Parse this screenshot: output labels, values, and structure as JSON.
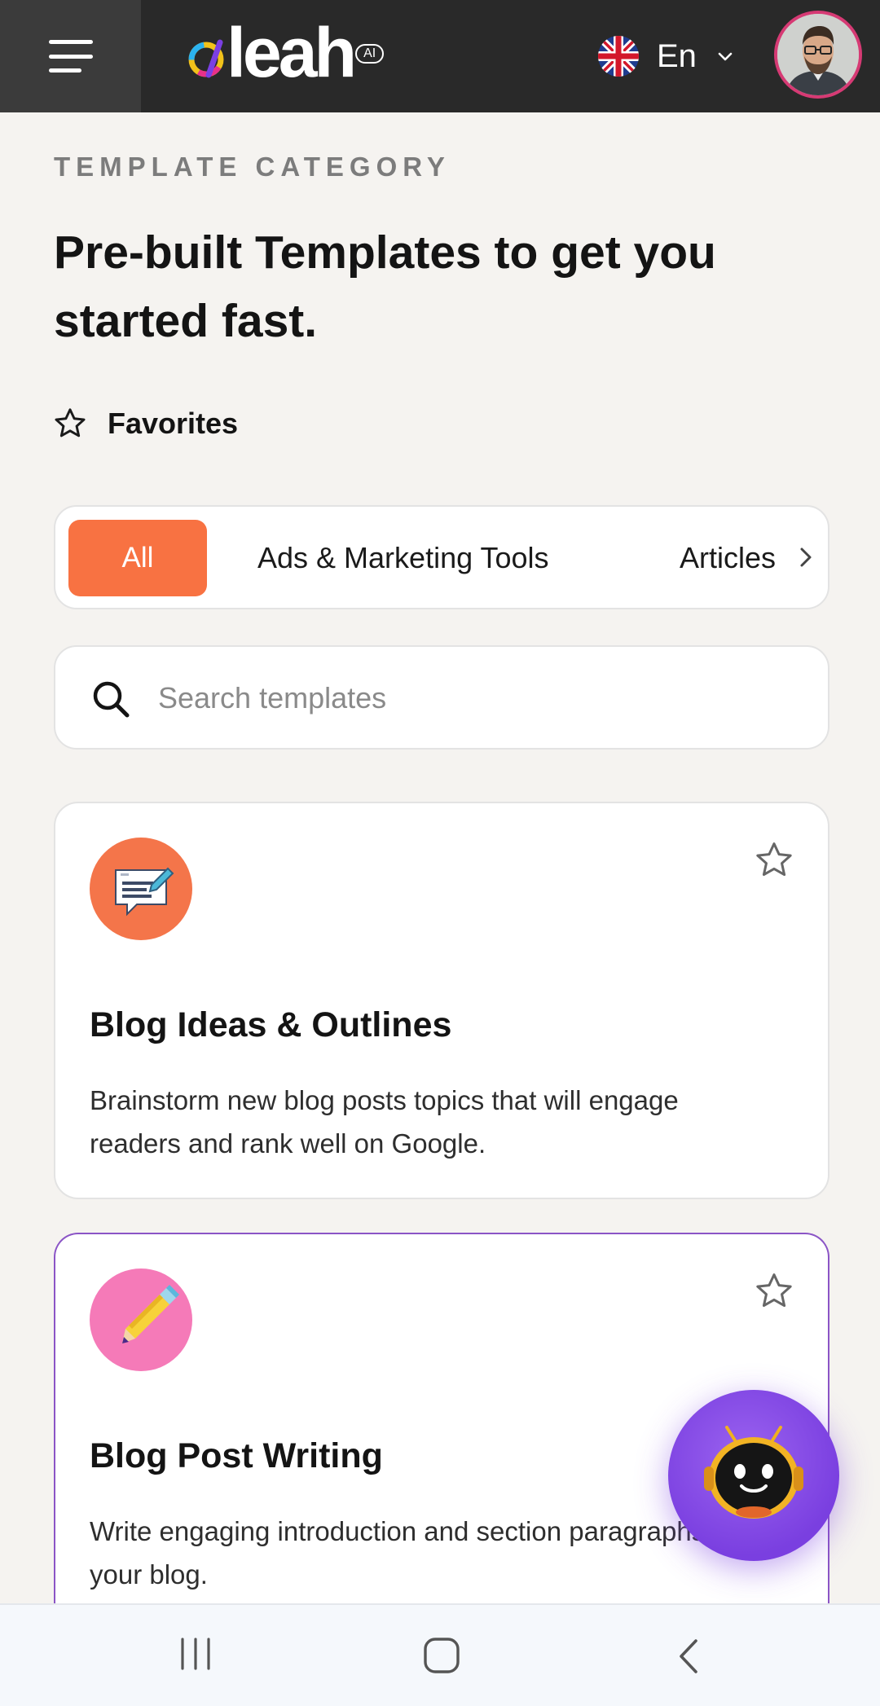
{
  "header": {
    "logo_text": "leah",
    "logo_badge": "AI",
    "language_label": "En"
  },
  "page": {
    "eyebrow": "TEMPLATE CATEGORY",
    "title": "Pre-built Templates to get you started fast.",
    "favorites_label": "Favorites"
  },
  "categories": {
    "active": "All",
    "items": [
      "All",
      "Ads & Marketing Tools",
      "Articles"
    ]
  },
  "search": {
    "placeholder": "Search templates",
    "value": ""
  },
  "templates": [
    {
      "title": "Blog Ideas & Outlines",
      "description": "Brainstorm new blog posts topics that will engage readers and rank well on Google.",
      "icon": "blog-document-icon",
      "icon_color": "#f4754a",
      "favorited": false
    },
    {
      "title": "Blog Post Writing",
      "description": "Write engaging introduction and section paragraphs for your blog.",
      "icon": "pencil-icon",
      "icon_color": "#f57ab8",
      "favorited": false
    }
  ],
  "colors": {
    "accent": "#f87242",
    "topbar": "#292929",
    "selected_card_border": "#8b55c6",
    "assistant_button": "#7a3fe0"
  }
}
